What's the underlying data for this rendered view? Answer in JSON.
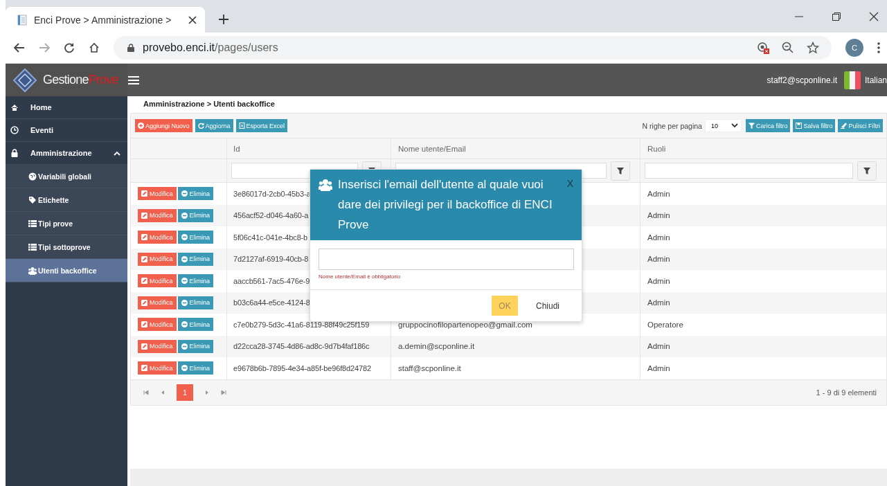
{
  "browser": {
    "tab_title": "Enci Prove > Amministrazione > ",
    "url_host": "provebo.enci.it",
    "url_path": "/pages/users",
    "profile": "C"
  },
  "header": {
    "brand": [
      "Gestione",
      "Prove"
    ],
    "user": "staff2@scponline.it",
    "language": "Italian"
  },
  "sidebar": {
    "items": [
      {
        "label": "Home",
        "selected": false
      },
      {
        "label": "Eventi",
        "selected": false
      },
      {
        "label": "Amministrazione",
        "selected": false,
        "expanded": true,
        "children": [
          {
            "label": "Variabili globali",
            "selected": false
          },
          {
            "label": "Etichette",
            "selected": false
          },
          {
            "label": "Tipi prove",
            "selected": false
          },
          {
            "label": "Tipi sottoprove",
            "selected": false
          },
          {
            "label": "Utenti backoffice",
            "selected": true
          }
        ]
      }
    ]
  },
  "breadcrumb": "Amministrazione > Utenti backoffice",
  "toolbar": {
    "buttons": [
      {
        "label": "Aggiungi Nuovo",
        "kind": "danger"
      },
      {
        "label": "Aggiorna",
        "kind": "info"
      },
      {
        "label": "Esporta Excel",
        "kind": "info"
      }
    ],
    "rows_per_page_label": "N righe per pagina",
    "rows_per_page": "10",
    "filter_buttons": [
      {
        "label": "Carica filtro"
      },
      {
        "label": "Salva filtro"
      },
      {
        "label": "Pulisci Filtri"
      }
    ]
  },
  "table": {
    "columns": [
      "Id",
      "Nome utente/Email",
      "Ruoli"
    ],
    "rows": [
      {
        "actions": [
          "Modifica",
          "Elimina"
        ],
        "id": "3e86017d-2cb0-45b3-a",
        "role": "Admin"
      },
      {
        "actions": [
          "Modifica",
          "Elimina"
        ],
        "id": "456acf52-d046-4a60-a",
        "role": "Admin"
      },
      {
        "actions": [
          "Modifica",
          "Elimina"
        ],
        "id": "5f06c41c-041e-4bc8-b",
        "role": "Admin"
      },
      {
        "actions": [
          "Modifica",
          "Elimina"
        ],
        "id": "7d2127af-6919-40cb-8",
        "role": "Admin"
      },
      {
        "actions": [
          "Modifica",
          "Elimina"
        ],
        "id": "aaccb561-7ac5-476e-9",
        "role": "Admin"
      },
      {
        "actions": [
          "Modifica",
          "Elimina"
        ],
        "id": "b03c6a44-e5ce-4124-8",
        "role": "Admin"
      },
      {
        "actions": [
          "Modifica",
          "Elimina"
        ],
        "id": "c7e0b279-5d3c-41a6-8119-88f49c25f159",
        "email": "gruppocinofilopartenopeo@gmail.com",
        "role": "Operatore"
      },
      {
        "actions": [
          "Modifica",
          "Elimina"
        ],
        "id": "d22cca28-3745-4d86-ad8c-9d7b4faf186c",
        "email": "a.demin@scponline.it",
        "role": "Admin"
      },
      {
        "actions": [
          "Modifica",
          "Elimina"
        ],
        "id": "e9678b6b-7895-4e34-a85f-be96f8d24782",
        "email": "staff@scponline.it",
        "role": "Admin"
      }
    ],
    "pages": [
      {
        "label": "1",
        "selected": true
      }
    ],
    "summary": "1 - 9 di 9 elementi"
  },
  "modal": {
    "title": "Inserisci l'email dell'utente al quale vuoi dare dei privilegi per il backoffice di ENCI Prove",
    "close": "X",
    "error": "Nome utente/Email è obbligatorio",
    "buttons": [
      {
        "label": "OK",
        "kind": "primary"
      },
      {
        "label": "Chiudi",
        "kind": "plain"
      }
    ]
  }
}
